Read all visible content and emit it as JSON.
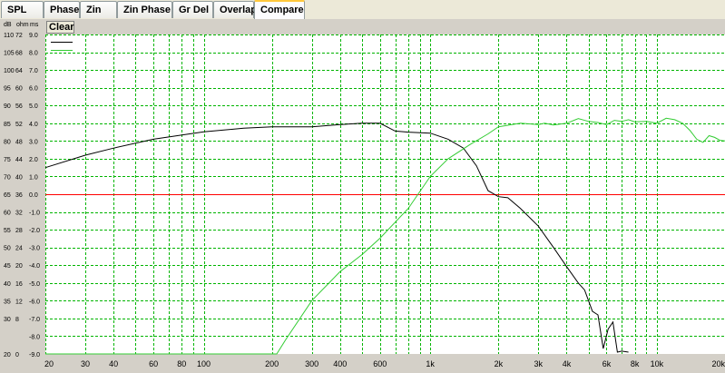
{
  "tabs": [
    {
      "label": "SPL",
      "active": false
    },
    {
      "label": "Phase",
      "active": false
    },
    {
      "label": "Zin",
      "active": false
    },
    {
      "label": "Zin Phase",
      "active": false
    },
    {
      "label": "Gr Del",
      "active": false
    },
    {
      "label": "Overlap",
      "active": false
    },
    {
      "label": "Compare",
      "active": true
    }
  ],
  "clear_label": "Clear",
  "colors": {
    "grid": "#00b400",
    "plot_bg": "#ffffff",
    "reference_line": "#ff0000",
    "series_black": "#000000",
    "series_green": "#33cc33"
  },
  "chart_data": {
    "type": "line",
    "x_scale": "log",
    "xlim": [
      20,
      20000
    ],
    "ylim_db": [
      20,
      110
    ],
    "axis_headers": [
      "dB",
      "ohm",
      "ms"
    ],
    "y_ticks_db": [
      "110",
      "105",
      "100",
      "95",
      "90",
      "85",
      "80",
      "75",
      "70",
      "65",
      "60",
      "55",
      "50",
      "45",
      "40",
      "35",
      "30",
      "20"
    ],
    "y_ticks_ohm": [
      "72",
      "68",
      "64",
      "60",
      "56",
      "52",
      "48",
      "44",
      "40",
      "36",
      "32",
      "28",
      "24",
      "20",
      "16",
      "12",
      "8",
      "0"
    ],
    "y_ticks_ms": [
      "9.0",
      "8.0",
      "7.0",
      "6.0",
      "5.0",
      "4.0",
      "3.0",
      "2.0",
      "1.0",
      "0.0",
      "-1.0",
      "-2.0",
      "-3.0",
      "-4.0",
      "-5.0",
      "-6.0",
      "-7.0",
      "-8.0",
      "-9.0"
    ],
    "x_tick_labels": [
      "20",
      "30",
      "40",
      "60",
      "80",
      "100",
      "200",
      "300",
      "400",
      "600",
      "1k",
      "2k",
      "3k",
      "4k",
      "6k",
      "8k",
      "10k",
      "20k"
    ],
    "x_tick_values": [
      20,
      30,
      40,
      60,
      80,
      100,
      200,
      300,
      400,
      600,
      1000,
      2000,
      3000,
      4000,
      6000,
      8000,
      10000,
      20000
    ],
    "reference_line_db": 65,
    "series": [
      {
        "color": "#000000",
        "x": [
          20,
          30,
          40,
          60,
          100,
          150,
          200,
          300,
          400,
          500,
          600,
          700,
          800,
          1000,
          1200,
          1400,
          1600,
          1800,
          2000,
          2200,
          2500,
          3000,
          3500,
          4000,
          4500,
          4800,
          5200,
          5500,
          5800,
          6100,
          6400,
          6700,
          7000,
          7500
        ],
        "y": [
          72.5,
          76,
          78,
          80.5,
          82.6,
          83.6,
          84,
          84,
          84.6,
          85,
          85,
          82.8,
          82.5,
          82.2,
          80.5,
          78,
          73,
          66,
          64.3,
          64,
          61,
          56,
          50,
          44.6,
          40,
          38,
          32,
          31,
          21.5,
          27,
          29,
          20.5,
          20.8,
          20.5
        ]
      },
      {
        "color": "#33cc33",
        "x": [
          20,
          200,
          210,
          230,
          300,
          400,
          500,
          600,
          800,
          1000,
          1200,
          1500,
          1800,
          2000,
          2500,
          3000,
          3200,
          3500,
          4000,
          4500,
          5000,
          5500,
          6000,
          6500,
          7000,
          7500,
          8000,
          9000,
          10000,
          11000,
          12000,
          13000,
          14000,
          15000,
          16000,
          17000,
          18000,
          19000,
          20000
        ],
        "y": [
          20,
          20,
          20,
          24,
          35,
          43.2,
          48,
          52.6,
          61,
          70,
          75,
          79,
          82,
          84,
          85,
          84.6,
          85,
          84.5,
          85,
          86.3,
          85.5,
          85.2,
          84.6,
          85.8,
          85.5,
          86,
          85.4,
          85.5,
          85,
          86.4,
          86,
          85,
          83,
          80.5,
          79.6,
          81.5,
          81,
          80.2,
          80
        ]
      }
    ]
  }
}
